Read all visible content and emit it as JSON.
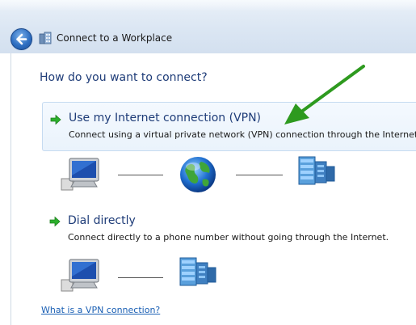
{
  "window": {
    "title": "Connect to a Workplace",
    "back_icon": "back-arrow-icon",
    "title_icon": "workplace-icon"
  },
  "main": {
    "heading": "How do you want to connect?",
    "options": [
      {
        "title": "Use my Internet connection (VPN)",
        "description": "Connect using a virtual private network (VPN) connection through the Internet.",
        "selected": true,
        "icon": "green-arrow-icon"
      },
      {
        "title": "Dial directly",
        "description": "Connect directly to a phone number without going through the Internet.",
        "selected": false,
        "icon": "green-arrow-icon"
      }
    ],
    "vpn_diagram": [
      "computer-icon",
      "globe-icon",
      "server-icon"
    ],
    "dial_diagram": [
      "computer-icon",
      "server-icon"
    ],
    "help_link": "What is a VPN connection?"
  },
  "colors": {
    "heading": "#1e3c78",
    "link": "#1a5fb4",
    "annotation_arrow": "#2e9a1f",
    "option_arrow": "#2bb02b"
  }
}
